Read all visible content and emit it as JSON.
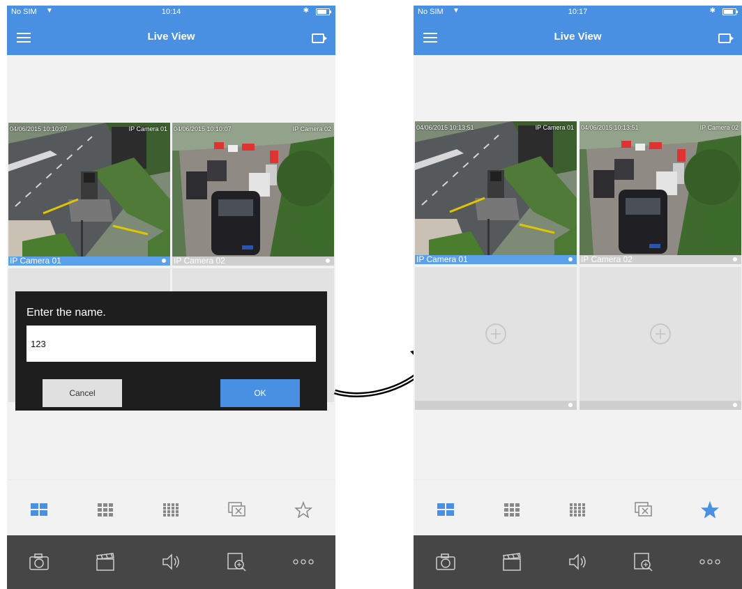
{
  "colors": {
    "accent": "#4a90e2",
    "toolbar_dark": "#464646",
    "background": "#f2f2f2",
    "dialog": "#1e1e1e"
  },
  "left_screen": {
    "status": {
      "carrier": "No SIM",
      "time": "10:14"
    },
    "nav": {
      "title": "Live View"
    },
    "tiles": [
      {
        "name": "IP Camera 01",
        "osd_date": "04/06/2015 10:10:07",
        "osd_cam": "IP Camera 01"
      },
      {
        "name": "IP Camera 02",
        "osd_date": "04/06/2015 10:10:07",
        "osd_cam": "IP Camera 02"
      }
    ],
    "dialog": {
      "title": "Enter the name.",
      "input_value": "123",
      "cancel_label": "Cancel",
      "ok_label": "OK"
    },
    "layout_bar": [
      "grid-2x2-icon",
      "grid-3x3-icon",
      "grid-4x4-icon",
      "close-all-icon",
      "favorite-star-outline-icon"
    ]
  },
  "right_screen": {
    "status": {
      "carrier": "No SIM",
      "time": "10:17"
    },
    "nav": {
      "title": "Live View"
    },
    "tiles": [
      {
        "name": "IP Camera 01",
        "osd_date": "04/06/2015 10:13:51",
        "osd_cam": "IP Camera 01"
      },
      {
        "name": "IP Camera 02",
        "osd_date": "04/06/2015 10:13:51",
        "osd_cam": "IP Camera 02"
      }
    ],
    "layout_bar": [
      "grid-2x2-icon",
      "grid-3x3-icon",
      "grid-4x4-icon",
      "close-all-icon",
      "favorite-star-filled-icon"
    ]
  },
  "action_bar": [
    "snapshot-icon",
    "record-clip-icon",
    "audio-icon",
    "digital-zoom-icon",
    "more-icon"
  ]
}
